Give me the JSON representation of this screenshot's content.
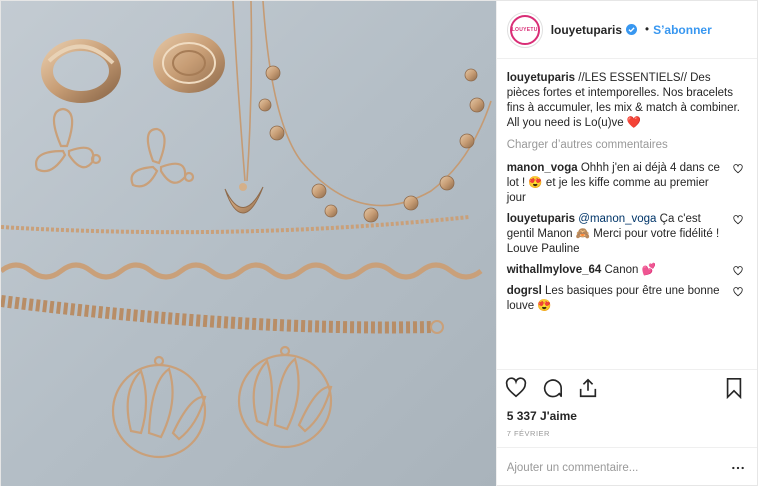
{
  "header": {
    "username": "louyetuparis",
    "follow_label": "S’abonner",
    "avatar_text": "LOUYETU"
  },
  "caption": {
    "username": "louyetuparis",
    "text": "//LES ESSENTIELS// Des pièces fortes et intemporelles. Nos bracelets fins à accumuler, les mix & match à combiner. All you need is Lo(u)ve ❤️"
  },
  "load_more_label": "Charger d’autres commentaires",
  "comments": [
    {
      "username": "manon_voga",
      "mention": "",
      "text": "Ohhh j'en ai déjà 4 dans ce lot ! 😍 et je les kiffe comme au premier jour"
    },
    {
      "username": "louyetuparis",
      "mention": "@manon_voga",
      "text": " Ça c'est gentil Manon 🙈 Merci pour votre fidélité ! Louve Pauline"
    },
    {
      "username": "withallmylove_64",
      "mention": "",
      "text": "Canon 💕"
    },
    {
      "username": "dogrsl",
      "mention": "",
      "text": "Les basiques pour être une bonne louve 😍"
    }
  ],
  "likes": "5 337 J'aime",
  "date": "7 FÉVRIER",
  "add_comment_placeholder": "Ajouter un commentaire...",
  "icons": [
    "verified-badge-icon",
    "heart-icon",
    "comment-icon",
    "share-icon",
    "bookmark-icon",
    "more-options-icon"
  ],
  "colors": {
    "link_blue": "#3897f0",
    "verified_blue": "#3897f0",
    "text": "#262626",
    "muted": "#999999"
  }
}
